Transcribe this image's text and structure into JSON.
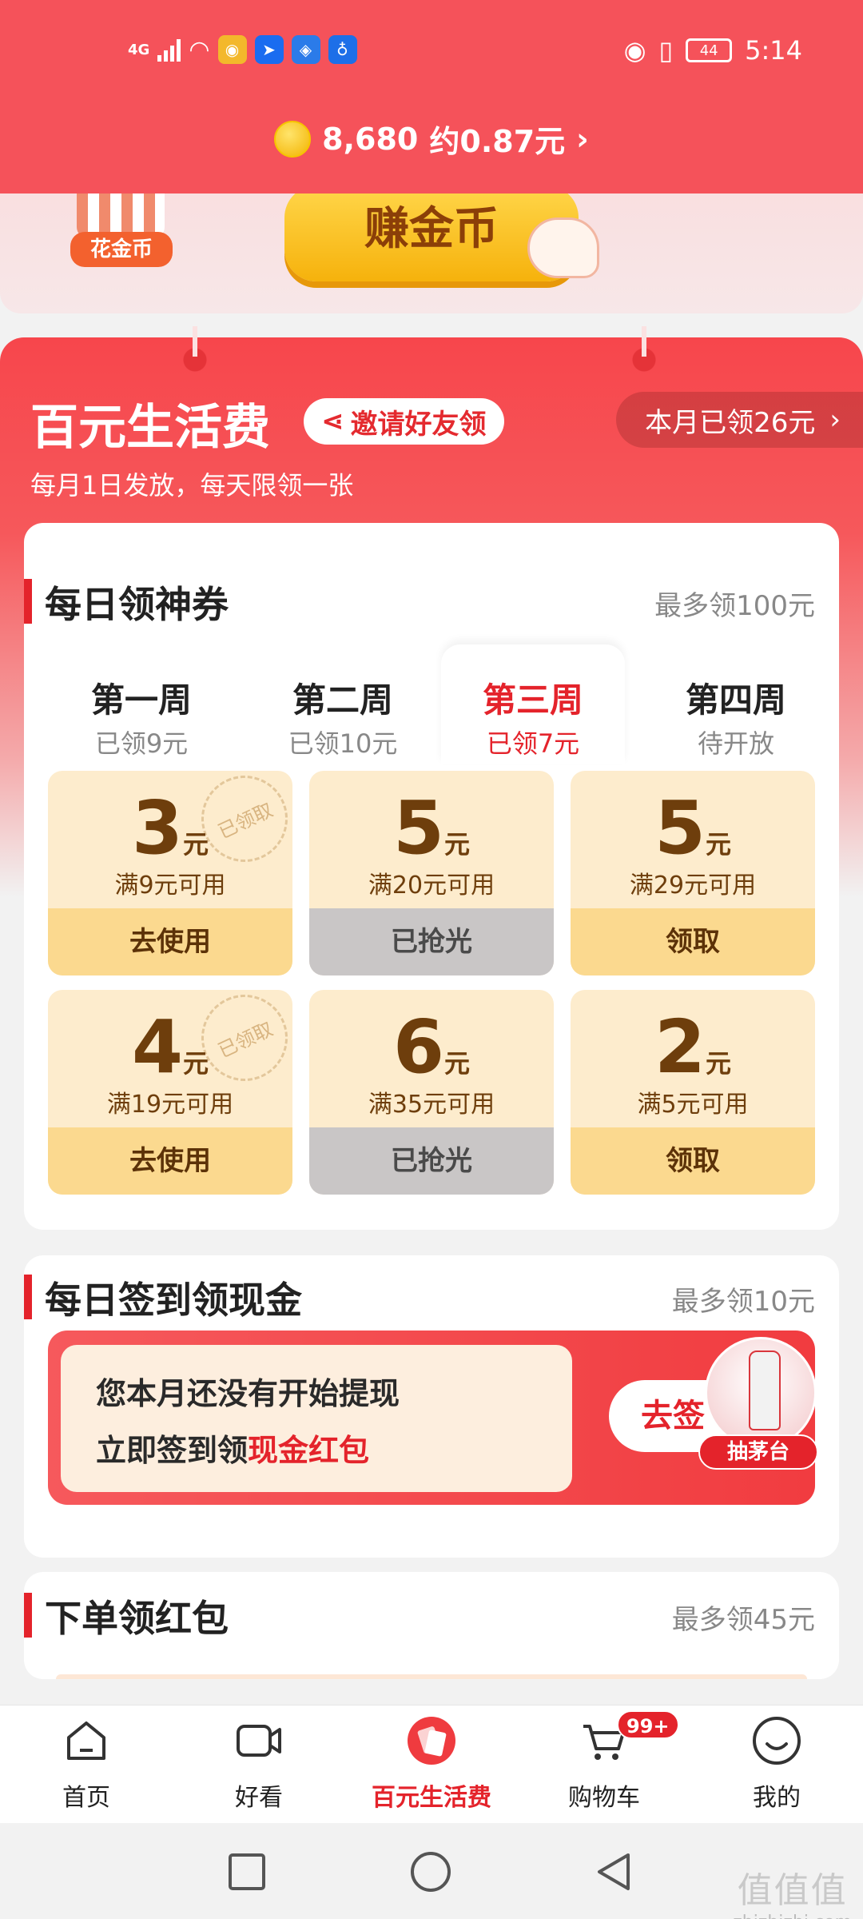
{
  "status_bar": {
    "network": "4G",
    "battery": "44",
    "time": "5:14"
  },
  "header": {
    "coin_count": "8,680",
    "coin_value": "约0.87元"
  },
  "banner": {
    "shop_tag": "花金币",
    "earn_button": "赚金币"
  },
  "main": {
    "title": "百元生活费",
    "invite_label": "邀请好友领",
    "month_received": "本月已领26元",
    "subtitle": "每月1日发放，每天限领一张"
  },
  "daily_coupon": {
    "title": "每日领神券",
    "max": "最多领100元",
    "weeks": [
      {
        "label": "第一周",
        "status": "已领9元"
      },
      {
        "label": "第二周",
        "status": "已领10元"
      },
      {
        "label": "第三周",
        "status": "已领7元"
      },
      {
        "label": "第四周",
        "status": "待开放"
      }
    ],
    "coupons": [
      {
        "amount": "3",
        "unit": "元",
        "condition": "满9元可用",
        "button": "去使用",
        "stamp": "已领取"
      },
      {
        "amount": "5",
        "unit": "元",
        "condition": "满20元可用",
        "button": "已抢光"
      },
      {
        "amount": "5",
        "unit": "元",
        "condition": "满29元可用",
        "button": "领取"
      },
      {
        "amount": "4",
        "unit": "元",
        "condition": "满19元可用",
        "button": "去使用",
        "stamp": "已领取"
      },
      {
        "amount": "6",
        "unit": "元",
        "condition": "满35元可用",
        "button": "已抢光"
      },
      {
        "amount": "2",
        "unit": "元",
        "condition": "满5元可用",
        "button": "领取"
      }
    ]
  },
  "sign_in": {
    "title": "每日签到领现金",
    "max": "最多领10元",
    "line1": "您本月还没有开始提现",
    "line2_prefix": "立即签到领",
    "line2_highlight": "现金红包",
    "button": "去签",
    "promo_tag": "抽茅台"
  },
  "order": {
    "title": "下单领红包",
    "max": "最多领45元"
  },
  "bottom_nav": [
    {
      "label": "首页"
    },
    {
      "label": "好看"
    },
    {
      "label": "百元生活费"
    },
    {
      "label": "购物车",
      "badge": "99+"
    },
    {
      "label": "我的"
    }
  ],
  "watermark": {
    "logo": "值值值",
    "domain": "zhizhizhi.com"
  },
  "colors": {
    "brand_red": "#e4232b",
    "header_red": "#f5525a",
    "coupon_bg": "#fdeccd",
    "coupon_button": "#fbd98f",
    "disabled_button": "#c9c6c6"
  }
}
